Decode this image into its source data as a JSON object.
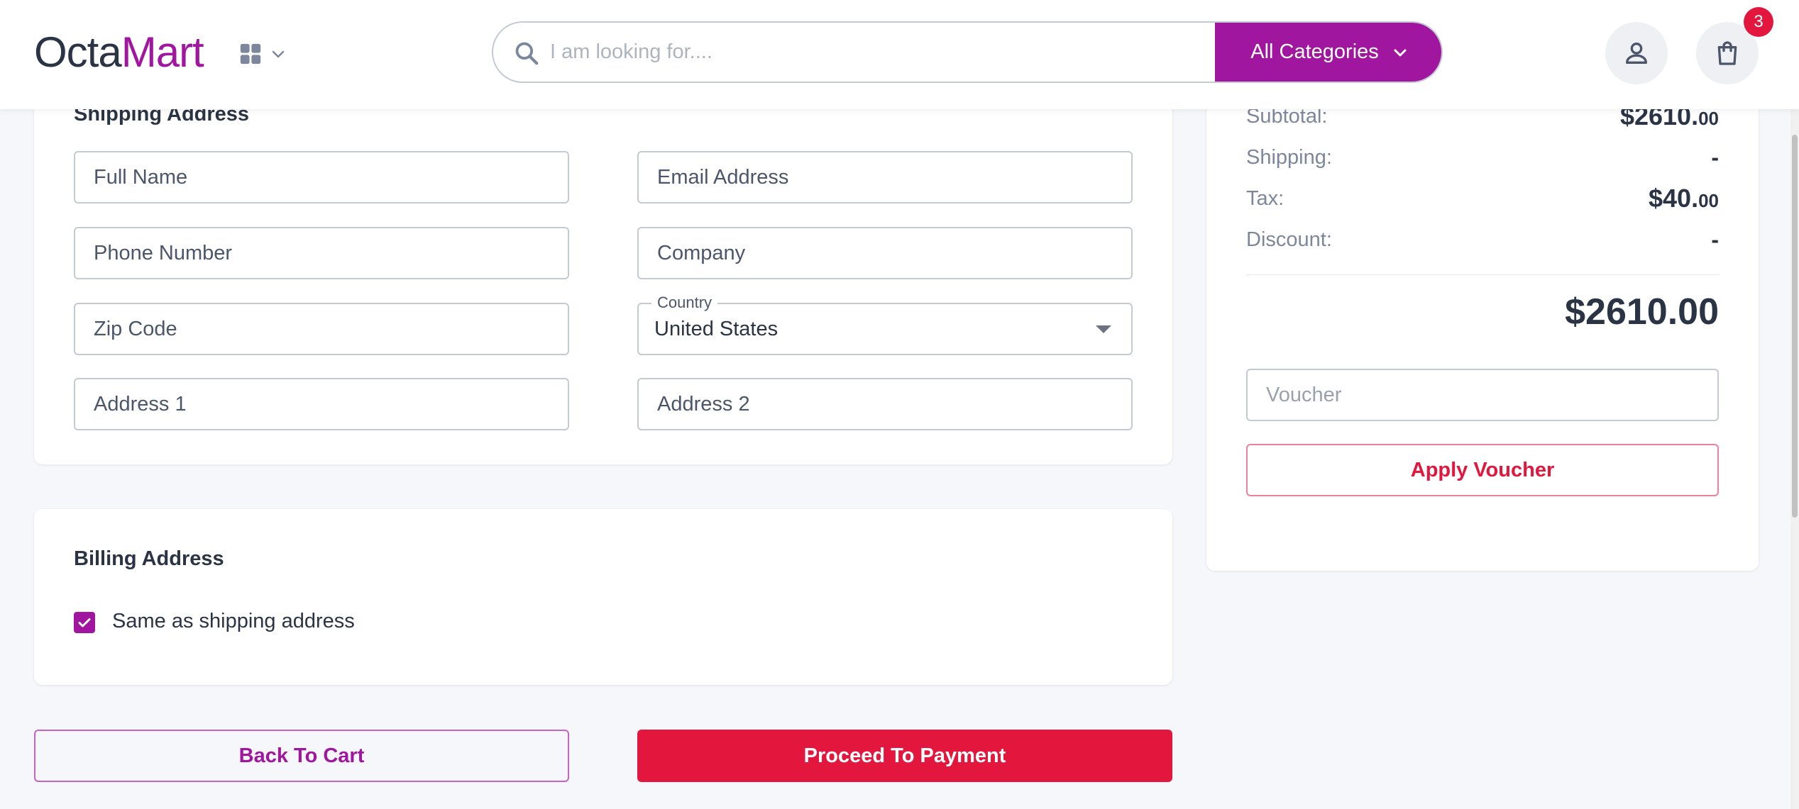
{
  "header": {
    "logo_part1": "Octa",
    "logo_part2": "Mart",
    "search_placeholder": "I am looking for....",
    "categories_label": "All Categories",
    "cart_count": "3",
    "icons": {
      "grid": "grid-icon",
      "chevron": "chevron-down-icon",
      "search": "search-icon",
      "user": "user-icon",
      "cart": "shopping-bag-icon"
    }
  },
  "shipping": {
    "title": "Shipping Address",
    "full_name_placeholder": "Full Name",
    "email_placeholder": "Email Address",
    "phone_placeholder": "Phone Number",
    "company_placeholder": "Company",
    "zip_placeholder": "Zip Code",
    "country_label": "Country",
    "country_value": "United States",
    "address1_placeholder": "Address 1",
    "address2_placeholder": "Address 2"
  },
  "billing": {
    "title": "Billing Address",
    "same_as_shipping_label": "Same as shipping address",
    "same_as_shipping_checked": true
  },
  "actions": {
    "back_label": "Back To Cart",
    "proceed_label": "Proceed To Payment"
  },
  "summary": {
    "subtotal_label": "Subtotal:",
    "subtotal_main": "$2610.",
    "subtotal_cents": "00",
    "shipping_label": "Shipping:",
    "shipping_value": "-",
    "tax_label": "Tax:",
    "tax_main": "$40.",
    "tax_cents": "00",
    "discount_label": "Discount:",
    "discount_value": "-",
    "total": "$2610.00",
    "voucher_placeholder": "Voucher",
    "apply_label": "Apply Voucher"
  },
  "colors": {
    "brand": "#a0169f",
    "danger": "#e3173e",
    "text": "#2b3445",
    "muted": "#7d879c",
    "background": "#f5f7fa"
  }
}
